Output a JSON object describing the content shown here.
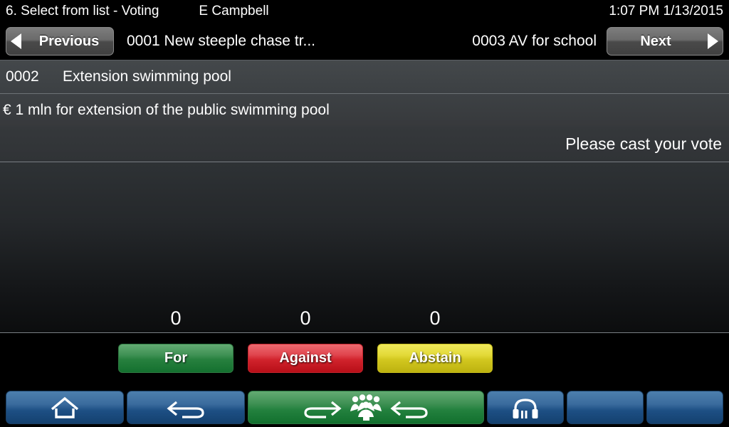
{
  "statusbar": {
    "title": "6. Select from list - Voting",
    "user": "E Campbell",
    "datetime": "1:07 PM 1/13/2015"
  },
  "navbar": {
    "previous_label": "Previous",
    "next_label": "Next",
    "previous_item": "0001 New steeple chase tr...",
    "next_item": "0003 AV for school"
  },
  "item": {
    "number": "0002",
    "title": "Extension swimming pool",
    "description": "€ 1 mln for extension of the public swimming pool",
    "status": "Please cast your vote"
  },
  "vote": {
    "options": [
      {
        "label": "For",
        "count": "0",
        "color": "#26803e"
      },
      {
        "label": "Against",
        "count": "0",
        "color": "#d1232c"
      },
      {
        "label": "Abstain",
        "count": "0",
        "color": "#d2c71f"
      }
    ]
  },
  "toolbar": {
    "buttons": [
      {
        "icon": "home-icon",
        "style": "blue"
      },
      {
        "icon": "back-arrow-icon",
        "style": "blue"
      },
      {
        "icon": "request-to-speak-group-icon",
        "style": "green"
      },
      {
        "icon": "headphones-icon",
        "style": "blue"
      },
      {
        "icon": "blank-icon",
        "style": "blue"
      },
      {
        "icon": "blank-icon",
        "style": "blue"
      }
    ]
  },
  "colors": {
    "accent_blue": "#1d4f84",
    "accent_green": "#26803e",
    "accent_red": "#d1232c",
    "accent_yellow": "#d2c71f",
    "panel_dark": "#2e3235",
    "background": "#000000"
  }
}
